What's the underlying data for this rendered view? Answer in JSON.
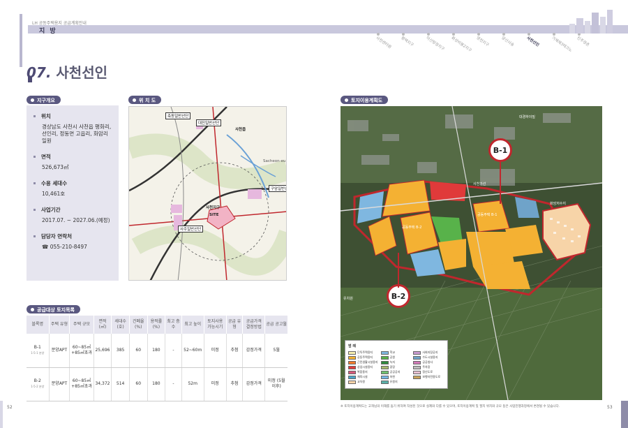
{
  "header": {
    "small_text": "LH 공동주택용지 공급계획안내",
    "title": "지 방",
    "regions": [
      "사천센터원",
      "평택지구",
      "아산탕정지구",
      "화성비봉2지구",
      "영천지구",
      "양산사송",
      "사천선인",
      "거제제3테크노",
      "진주정촌"
    ],
    "active_region": "사천선인"
  },
  "section": {
    "number": "07.",
    "name": "사천선인"
  },
  "labels": {
    "overview": "지구개요",
    "location": "위 치 도",
    "landuse": "토지이용계획도",
    "supply": "공급대상 토지목록"
  },
  "overview": [
    {
      "label": "위치",
      "value": "경상남도 사천시 사천읍 평화리, 선인리, 정동면 고읍리, 화암리 일원"
    },
    {
      "label": "면적",
      "value": "526,673㎡"
    },
    {
      "label": "수용 세대수",
      "value": "10,461호"
    },
    {
      "label": "사업기간",
      "value": "2017.07. ~ 2027.06.(예정)"
    },
    {
      "label": "담당자 연락처",
      "value": "☎ 055-210-8497"
    }
  ],
  "locmap": {
    "labels": [
      "축동일반산단",
      "대진일반산단",
      "사천읍",
      "Sacheon-eup",
      "구암일반산단",
      "사천지구",
      "SITE",
      "사주일반산단"
    ]
  },
  "table": {
    "headers": [
      "블록명",
      "주택 유형",
      "주택 규모",
      "면적 (㎡)",
      "세대수 (호)",
      "건폐율 (%)",
      "용적률 (%)",
      "최고 층수",
      "최고 높이",
      "토지사용 가능시기",
      "공급 유형",
      "공급가격 결정방법",
      "공급 공고월"
    ],
    "rows": [
      {
        "block": "B-1",
        "block_sub": "1-5-1 분양",
        "type": "분양APT",
        "size": "60~85㎡ +85㎡초과",
        "area": "25,696",
        "units": "385",
        "bcr": "60",
        "far": "180",
        "floors": "-",
        "height": "52~60m",
        "use_time": "미정",
        "supply": "추첨",
        "price": "감정가격",
        "month": "5월"
      },
      {
        "block": "B-2",
        "block_sub": "1-5-2 분양",
        "type": "분양APT",
        "size": "60~85㎡ +85㎡초과",
        "area": "34,372",
        "units": "514",
        "bcr": "60",
        "far": "180",
        "floors": "-",
        "height": "52m",
        "use_time": "미정",
        "supply": "추첨",
        "price": "감정가격",
        "month": "미정 (5월 이후)"
      }
    ]
  },
  "landmap": {
    "pins": [
      "B-1",
      "B-2"
    ],
    "legend_title": "범 례",
    "legend": [
      {
        "label": "단독주택용지",
        "color": "#f6efb0"
      },
      {
        "label": "학교",
        "color": "#7fb7e0"
      },
      {
        "label": "사회지장공지",
        "color": "#c99bd0"
      },
      {
        "label": "공동주택용지",
        "color": "#f4b133"
      },
      {
        "label": "공원",
        "color": "#58b24a"
      },
      {
        "label": "수도시설용지",
        "color": "#6fa3c9"
      },
      {
        "label": "근린생활시설용지",
        "color": "#f27a2b"
      },
      {
        "label": "녹지",
        "color": "#2e8b3e"
      },
      {
        "label": "공공청사",
        "color": "#d17ab8"
      },
      {
        "label": "상업시설용지",
        "color": "#e03a3a"
      },
      {
        "label": "광장",
        "color": "#a5b86e"
      },
      {
        "label": "주차장",
        "color": "#bdbdbd"
      },
      {
        "label": "복합용지",
        "color": "#d65a7a"
      },
      {
        "label": "공공공지",
        "color": "#6fc16f"
      },
      {
        "label": "정신도로",
        "color": "#e8c1d1"
      },
      {
        "label": "체육시설",
        "color": "#4aa3c8"
      },
      {
        "label": "하천",
        "color": "#73b6e4"
      },
      {
        "label": "보행자전용도로",
        "color": "#c9a25a"
      },
      {
        "label": "교차원",
        "color": "#f7d4a8"
      },
      {
        "label": "유원지",
        "color": "#5bb0a8"
      }
    ],
    "map_labels": [
      "대경하이빌",
      "화암저수지",
      "사천가선",
      "유치원",
      "공동주택 B-1",
      "공동주택 B-2"
    ]
  },
  "note": "※ 토지이용계획도는 고객님의 이해를 돕기 위하여 작성된 것으로 실제와 다를 수 있으며, 토지이용계획 및 필지 위치와 규모 등은 사업진행과정에서 변경될 수 있습니다.",
  "page_left": "52",
  "page_right": "53"
}
